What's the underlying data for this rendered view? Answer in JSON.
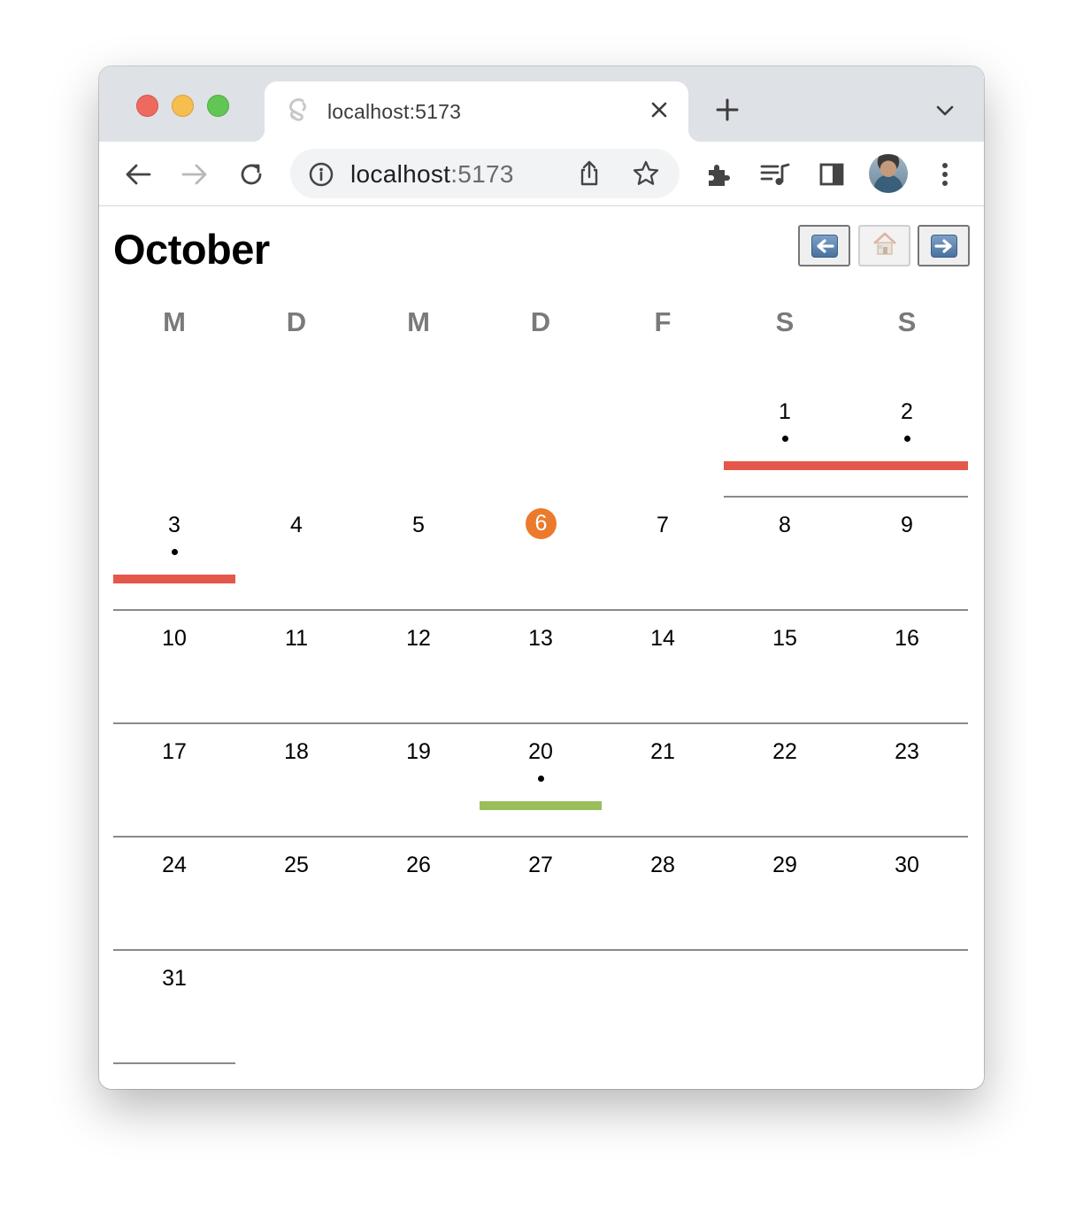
{
  "browser": {
    "tab": {
      "title": "localhost:5173",
      "favicon": "svelte-icon"
    },
    "omnibox": {
      "host": "localhost",
      "port": ":5173"
    }
  },
  "calendar": {
    "month": "October",
    "nav": {
      "prev": "previous-month",
      "home": "current-month",
      "next": "next-month"
    },
    "weekdays": [
      "M",
      "D",
      "M",
      "D",
      "F",
      "S",
      "S"
    ],
    "today": 6,
    "weeks": [
      [
        null,
        null,
        null,
        null,
        null,
        1,
        2
      ],
      [
        3,
        4,
        5,
        6,
        7,
        8,
        9
      ],
      [
        10,
        11,
        12,
        13,
        14,
        15,
        16
      ],
      [
        17,
        18,
        19,
        20,
        21,
        22,
        23
      ],
      [
        24,
        25,
        26,
        27,
        28,
        29,
        30
      ],
      [
        31,
        null,
        null,
        null,
        null,
        null,
        null
      ]
    ],
    "events": [
      {
        "days": [
          1,
          2,
          3
        ],
        "color": "#e5574a"
      },
      {
        "days": [
          20
        ],
        "color": "#9abe5a"
      }
    ],
    "colors": {
      "today": "#ec7a2c",
      "weekday_label": "#7a7a7a"
    }
  }
}
